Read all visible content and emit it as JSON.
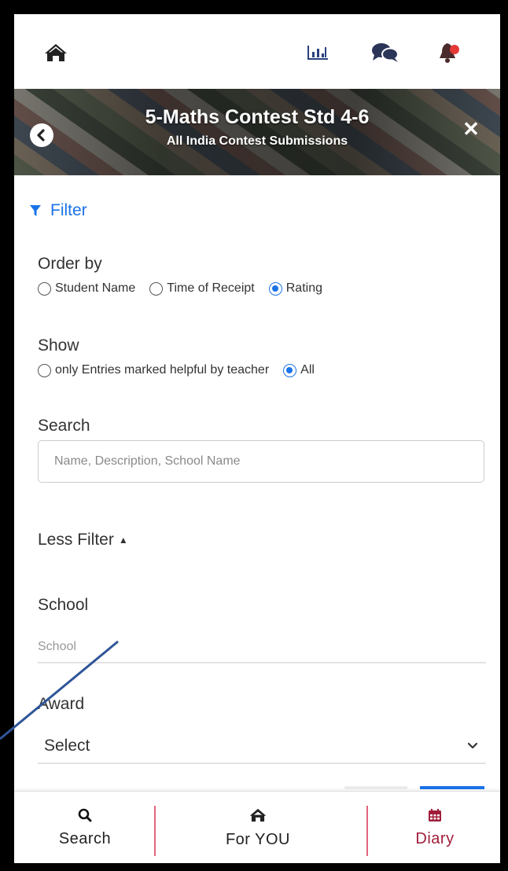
{
  "banner": {
    "title": "5-Maths Contest Std 4-6",
    "subtitle": "All India Contest Submissions"
  },
  "filter": {
    "label": "Filter",
    "order_by": {
      "label": "Order by",
      "options": [
        "Student Name",
        "Time of Receipt",
        "Rating"
      ],
      "selected": "Rating"
    },
    "show": {
      "label": "Show",
      "options": [
        "only Entries marked helpful by teacher",
        "All"
      ],
      "selected": "All"
    },
    "search": {
      "label": "Search",
      "placeholder": "Name, Description, School Name"
    },
    "less_filter_label": "Less Filter",
    "school": {
      "label": "School",
      "placeholder": "School"
    },
    "award": {
      "label": "Award",
      "value": "Select"
    }
  },
  "bottom_nav": {
    "search": "Search",
    "for_you": "For YOU",
    "diary": "Diary"
  },
  "colors": {
    "accent": "#1a73e8",
    "diary": "#a01e3a",
    "notification_dot": "#e53935",
    "divider": "#e3657c"
  },
  "icons": [
    "home-icon",
    "bar-chart-icon",
    "chat-icon",
    "bell-icon",
    "back-icon",
    "close-icon",
    "funnel-icon",
    "caret-up-icon",
    "chevron-down-icon",
    "search-icon",
    "calendar-icon"
  ]
}
